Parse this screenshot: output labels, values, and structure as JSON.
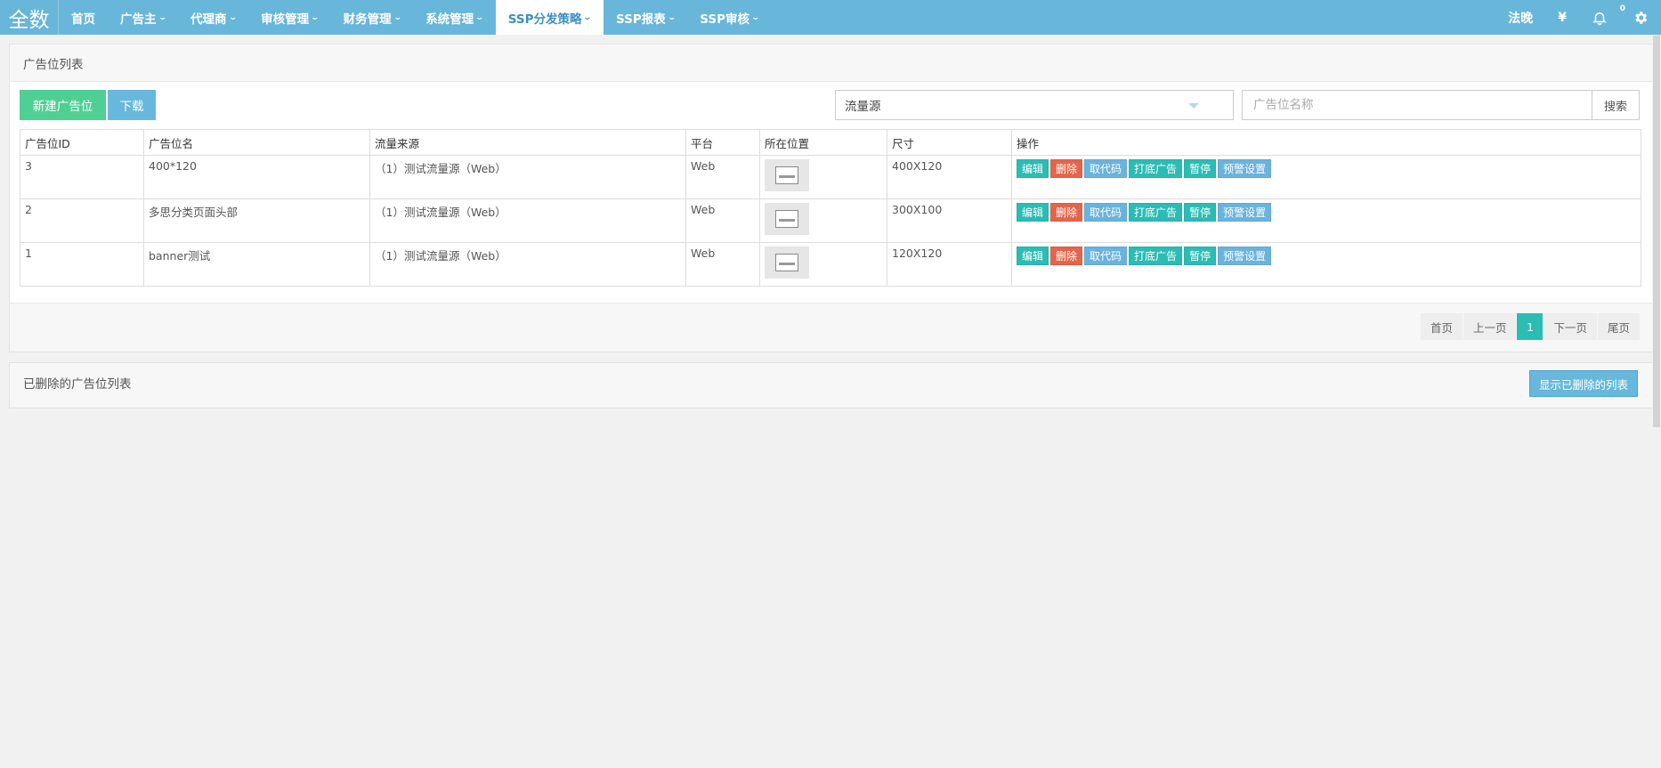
{
  "topbar": {
    "brand": "全数",
    "nav": [
      {
        "label": "首页",
        "dropdown": false,
        "active": false
      },
      {
        "label": "广告主",
        "dropdown": true,
        "active": false
      },
      {
        "label": "代理商",
        "dropdown": true,
        "active": false
      },
      {
        "label": "审核管理",
        "dropdown": true,
        "active": false
      },
      {
        "label": "财务管理",
        "dropdown": true,
        "active": false
      },
      {
        "label": "系统管理",
        "dropdown": true,
        "active": false
      },
      {
        "label": "SSP分发策略",
        "dropdown": true,
        "active": true
      },
      {
        "label": "SSP报表",
        "dropdown": true,
        "active": false
      },
      {
        "label": "SSP审核",
        "dropdown": true,
        "active": false
      }
    ],
    "right": {
      "user": "法晚",
      "yen_icon": "¥",
      "notification_count": "0",
      "bell_icon": "🔔",
      "gear_icon": "⚙"
    }
  },
  "list_panel": {
    "title": "广告位列表",
    "new_button": "新建广告位",
    "download_button": "下载",
    "filter_select": "流量源",
    "search_placeholder": "广告位名称",
    "search_button": "搜索",
    "columns": [
      "广告位ID",
      "广告位名",
      "流量来源",
      "平台",
      "所在位置",
      "尺寸",
      "操作"
    ],
    "rows": [
      {
        "id": "3",
        "name": "400*120",
        "source": "（1）测试流量源（Web）",
        "platform": "Web",
        "size": "400X120"
      },
      {
        "id": "2",
        "name": "多思分类页面头部",
        "source": "（1）测试流量源（Web）",
        "platform": "Web",
        "size": "300X100"
      },
      {
        "id": "1",
        "name": "banner测试",
        "source": "（1）测试流量源（Web）",
        "platform": "Web",
        "size": "120X120"
      }
    ],
    "ops": {
      "edit": "编辑",
      "delete": "删除",
      "get_code": "取代码",
      "fallback_ad": "打底广告",
      "pause": "暂停",
      "alert_settings": "预警设置"
    },
    "pager": {
      "first": "首页",
      "prev": "上一页",
      "current": "1",
      "next": "下一页",
      "last": "尾页"
    }
  },
  "deleted_panel": {
    "title": "已删除的广告位列表",
    "show_button": "显示已删除的列表"
  },
  "colors": {
    "topbar": "#68b6da",
    "green": "#4fcf94",
    "teal": "#2bbcb4",
    "red": "#e4654b",
    "blue": "#67b8dc"
  }
}
